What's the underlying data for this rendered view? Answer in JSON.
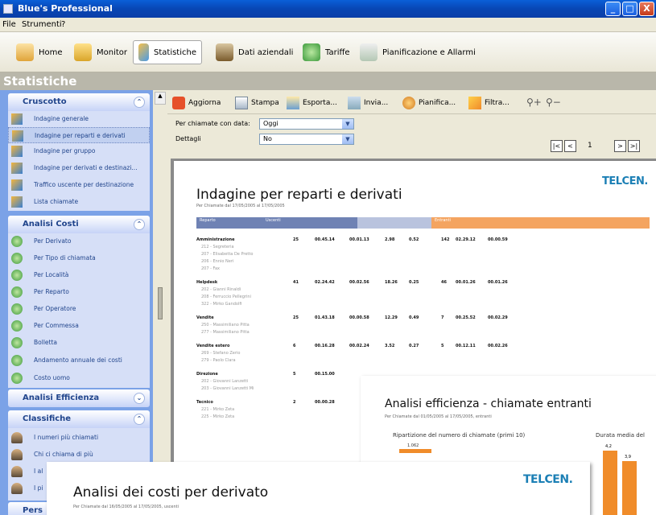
{
  "window": {
    "title": "Blue's Professional",
    "controls": [
      "_",
      "□",
      "X"
    ]
  },
  "menu": [
    "File",
    "Strumenti",
    "?"
  ],
  "toolbar": [
    {
      "label": "Home",
      "icon": "home-icon"
    },
    {
      "label": "Monitor",
      "icon": "monitor-icon"
    },
    {
      "label": "Statistiche",
      "icon": "statistics-icon",
      "active": true
    },
    {
      "label": "Dati aziendali",
      "icon": "company-data-icon"
    },
    {
      "label": "Tariffe",
      "icon": "tariff-icon"
    },
    {
      "label": "Pianificazione e Allarmi",
      "icon": "schedule-icon"
    }
  ],
  "section_title": "Statistiche",
  "sidebar": {
    "cruscotto": {
      "title": "Cruscotto",
      "items": [
        "Indagine generale",
        "Indagine per reparti e derivati",
        "Indagine per gruppo",
        "Indagine per derivati e destinazi...",
        "Traffico uscente per destinazione",
        "Lista chiamate"
      ]
    },
    "analisi_costi": {
      "title": "Analisi Costi",
      "items": [
        "Per Derivato",
        "Per Tipo di chiamata",
        "Per Località",
        "Per Reparto",
        "Per Operatore",
        "Per Commessa",
        "Bolletta",
        "Andamento annuale dei costi",
        "Costo uomo"
      ]
    },
    "analisi_efficienza": {
      "title": "Analisi Efficienza"
    },
    "classifiche": {
      "title": "Classifiche",
      "items": [
        "I numeri più chiamati",
        "Chi ci chiama di più",
        "I al",
        "I pi"
      ]
    },
    "pers": {
      "title": "Pers"
    }
  },
  "actions": [
    "Aggiorna",
    "Stampa",
    "Esporta...",
    "Invia...",
    "Pianifica...",
    "Filtra..."
  ],
  "filters": {
    "chiamate_label": "Per chiamate con data:",
    "chiamate_value": "Oggi",
    "dettagli_label": "Dettagli",
    "dettagli_value": "No"
  },
  "pager": {
    "page": "1"
  },
  "report1": {
    "title": "Indagine per reparti e derivati",
    "subtitle": "Per Chiamate dal 17/05/2005 al 17/05/2005",
    "logo": "TELCEN.",
    "header_uscenti": "Uscenti",
    "header_entranti": "Entranti",
    "header_reparto": "Reparto",
    "groups": [
      {
        "name": "Amministrazione",
        "n": "25",
        "durata": "00.45.14",
        "media": "00.01.13",
        "costo": "2.98",
        "costo_medio": "0.52",
        "in_n": "142",
        "in_durata": "02.29.12",
        "in_media": "00.00.59",
        "rows": [
          "212 - Segreteria",
          "207 - Elisabetta De Pretto",
          "206 - Ennio Neri",
          "207 - Fax"
        ]
      },
      {
        "name": "Helpdesk",
        "n": "41",
        "durata": "02.24.42",
        "media": "00.02.56",
        "costo": "18.26",
        "costo_medio": "0.25",
        "in_n": "46",
        "in_durata": "00.01.26",
        "in_media": "00.01.26",
        "rows": [
          "202 - Gianni Rinaldi",
          "208 - Ferruccio Pellegrini",
          "322 - Mirko Gandolfi"
        ]
      },
      {
        "name": "Vendite",
        "n": "25",
        "durata": "01.43.18",
        "media": "00.00.58",
        "costo": "12.29",
        "costo_medio": "0.49",
        "in_n": "7",
        "in_durata": "00.25.52",
        "in_media": "00.02.29",
        "rows": [
          "250 - Massimiliano Pitta",
          "277 - Massimiliano Pitta"
        ]
      },
      {
        "name": "Vendite estero",
        "n": "6",
        "durata": "00.16.28",
        "media": "00.02.24",
        "costo": "3.52",
        "costo_medio": "0.27",
        "in_n": "5",
        "in_durata": "00.12.11",
        "in_media": "00.02.26",
        "rows": [
          "269 - Stefano Zerio",
          "279 - Paolo Clara"
        ]
      },
      {
        "name": "Direzione",
        "n": "5",
        "durata": "00.15.00",
        "rows": [
          "202 - Giovanni Lanzetti",
          "203 - Giovanni Lanzetti Mi"
        ]
      },
      {
        "name": "Tecnico",
        "n": "2",
        "durata": "00.00.28",
        "rows": [
          "221 - Mirko Zeta",
          "225 - Mirko Zeta"
        ]
      }
    ]
  },
  "report2": {
    "title": "Analisi efficienza - chiamate entranti",
    "subtitle": "Per Chiamate dal 01/05/2005 al 17/05/2005, entranti",
    "chart_left_label": "Ripartizione del numero di chiamate (primi 10)",
    "chart_left_first": "1.062",
    "chart_right_label": "Durata media del",
    "bar_labels": [
      "4,2",
      "3,9"
    ]
  },
  "report3": {
    "title": "Analisi dei costi per derivato",
    "subtitle": "Per Chiamate dal 16/05/2005 al 17/05/2005, uscenti",
    "logo": "TELCEN."
  },
  "colors": {
    "titlebar": "#0a4fc8",
    "sidebar": "#7ba2e7",
    "accent": "#f08c2a",
    "logo": "#1b7fb5"
  }
}
